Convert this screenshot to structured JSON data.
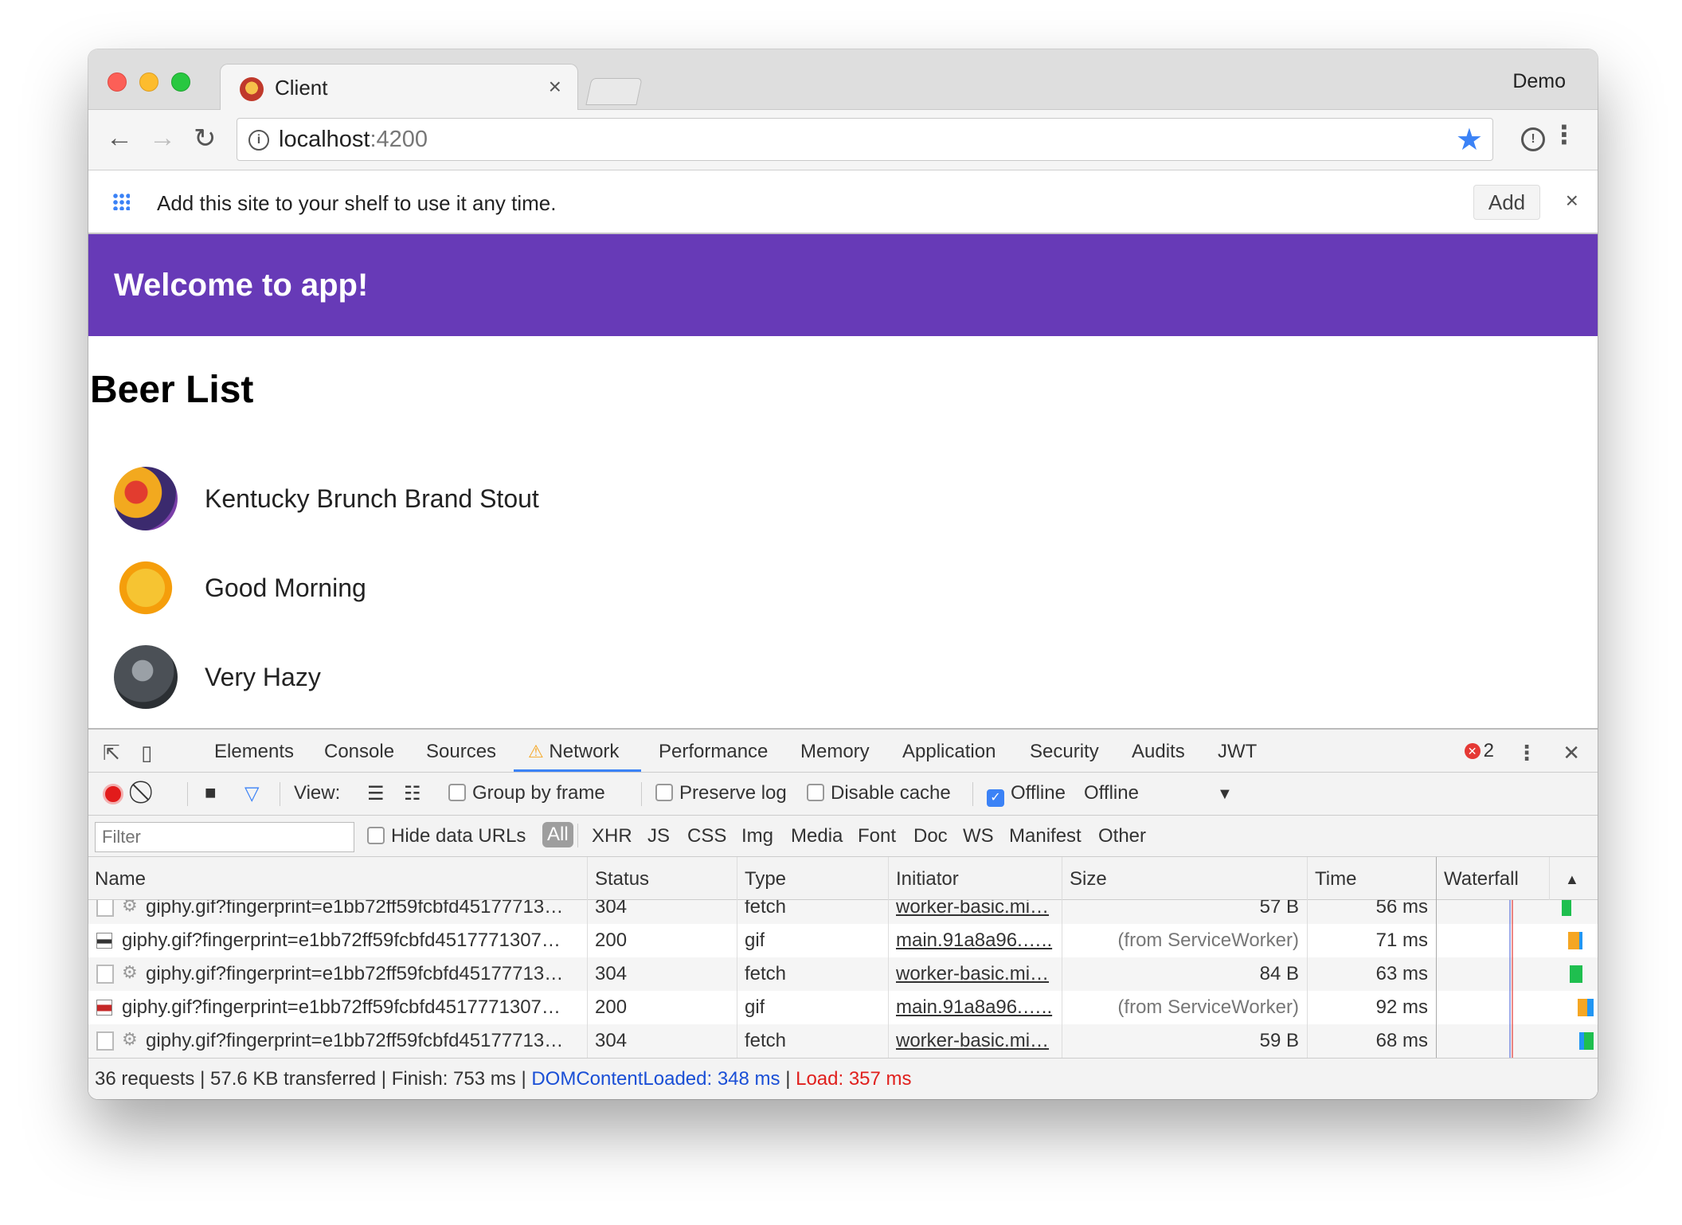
{
  "browser": {
    "tab_title": "Client",
    "tab_close": "×",
    "profile": "Demo",
    "url_host": "localhost",
    "url_port": ":4200",
    "star": "★"
  },
  "infobar": {
    "text": "Add this site to your shelf to use it any time.",
    "add_label": "Add",
    "close": "×"
  },
  "app": {
    "title": "Welcome to app!",
    "heading": "Beer List",
    "beers": [
      {
        "name": "Kentucky Brunch Brand Stout"
      },
      {
        "name": "Good Morning"
      },
      {
        "name": "Very Hazy"
      }
    ]
  },
  "devtools": {
    "tabs": [
      "Elements",
      "Console",
      "Sources",
      "Network",
      "Performance",
      "Memory",
      "Application",
      "Security",
      "Audits",
      "JWT"
    ],
    "active_tab": "Network",
    "error_count": "2",
    "toolbar": {
      "view_label": "View:",
      "group_by_frame": "Group by frame",
      "preserve_log": "Preserve log",
      "disable_cache": "Disable cache",
      "offline_checkbox": "Offline",
      "throttle_select": "Offline"
    },
    "filter": {
      "placeholder": "Filter",
      "hide_data_urls": "Hide data URLs",
      "types": [
        "All",
        "XHR",
        "JS",
        "CSS",
        "Img",
        "Media",
        "Font",
        "Doc",
        "WS",
        "Manifest",
        "Other"
      ]
    },
    "columns": [
      "Name",
      "Status",
      "Type",
      "Initiator",
      "Size",
      "Time",
      "Waterfall"
    ],
    "rows": [
      {
        "name": "giphy.gif?fingerprint=e1bb72ff59fcbfd45177713…",
        "status": "304",
        "type": "fetch",
        "initiator": "worker-basic.mi…",
        "size": "57 B",
        "time": "56 ms"
      },
      {
        "name": "giphy.gif?fingerprint=e1bb72ff59fcbfd4517771307…",
        "status": "200",
        "type": "gif",
        "initiator": "main.91a8a96.…..",
        "size": "(from ServiceWorker)",
        "time": "71 ms"
      },
      {
        "name": "giphy.gif?fingerprint=e1bb72ff59fcbfd45177713…",
        "status": "304",
        "type": "fetch",
        "initiator": "worker-basic.mi…",
        "size": "84 B",
        "time": "63 ms"
      },
      {
        "name": "giphy.gif?fingerprint=e1bb72ff59fcbfd4517771307…",
        "status": "200",
        "type": "gif",
        "initiator": "main.91a8a96.…..",
        "size": "(from ServiceWorker)",
        "time": "92 ms"
      },
      {
        "name": "giphy.gif?fingerprint=e1bb72ff59fcbfd45177713…",
        "status": "304",
        "type": "fetch",
        "initiator": "worker-basic.mi…",
        "size": "59 B",
        "time": "68 ms"
      }
    ],
    "summary": {
      "requests": "36 requests",
      "transferred": "57.6 KB transferred",
      "finish": "Finish: 753 ms",
      "dcl": "DOMContentLoaded: 348 ms",
      "load": "Load: 357 ms",
      "divider": "|"
    }
  }
}
